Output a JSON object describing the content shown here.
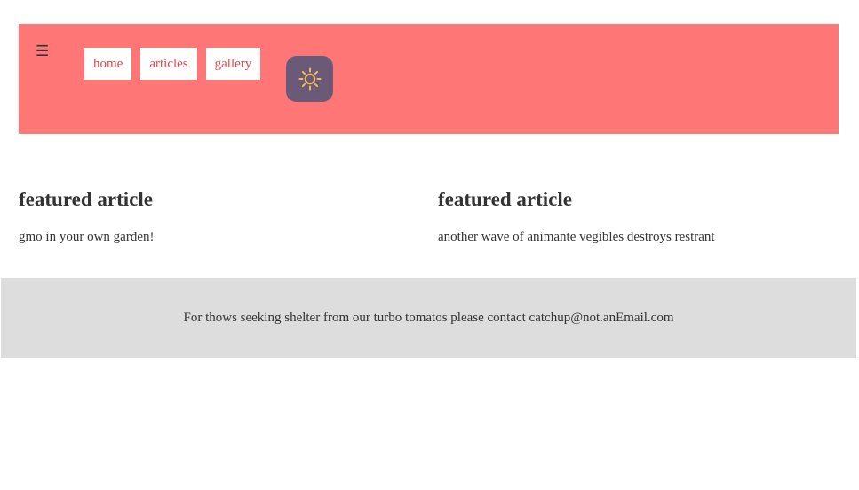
{
  "header": {
    "menu_icon": "☰",
    "nav": [
      {
        "label": "home"
      },
      {
        "label": "articles"
      },
      {
        "label": "gallery"
      }
    ],
    "theme_toggle_icon": "sun-icon",
    "colors": {
      "header_bg": "#ff7676",
      "nav_text": "#e0474c",
      "toggle_bg": "#6a5a78",
      "sun": "#f4b860"
    }
  },
  "main": {
    "articles": [
      {
        "title": "featured article",
        "summary": "gmo in your own garden!"
      },
      {
        "title": "featured article",
        "summary": "another wave of animante vegibles destroys restrant"
      }
    ]
  },
  "footer": {
    "text": "For thows seeking shelter from our turbo tomatos please contact catchup@not.anEmail.com",
    "bg": "#dddddd"
  }
}
